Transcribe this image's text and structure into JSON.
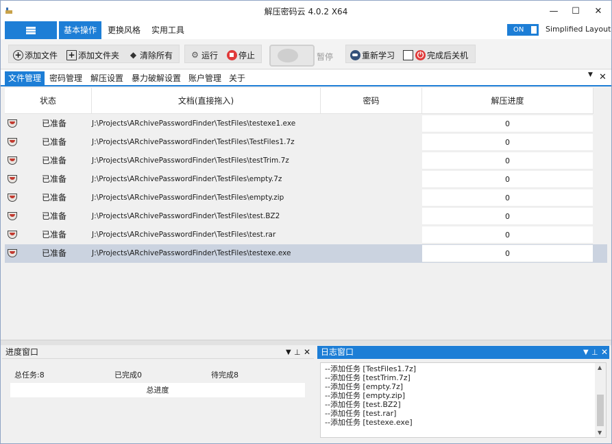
{
  "window": {
    "title": "解压密码云 4.0.2    X64",
    "minimize_glyph": "—",
    "maximize_glyph": "☐",
    "close_glyph": "✕"
  },
  "ribbon": {
    "tabs": [
      {
        "label": "基本操作",
        "active": true
      },
      {
        "label": "更换风格",
        "active": false
      },
      {
        "label": "实用工具",
        "active": false
      }
    ],
    "toggle_label": "ON",
    "layout_label": "Simplified Layout"
  },
  "toolbar": {
    "add_file": "添加文件",
    "add_folder": "添加文件夹",
    "clear_all": "清除所有",
    "run": "运行",
    "stop": "停止",
    "pause": "暂停",
    "relearn": "重新学习",
    "shutdown_after": "完成后关机"
  },
  "doc_tabs": [
    {
      "label": "文件管理",
      "active": true
    },
    {
      "label": "密码管理",
      "active": false
    },
    {
      "label": "解压设置",
      "active": false
    },
    {
      "label": "暴力破解设置",
      "active": false
    },
    {
      "label": "账户管理",
      "active": false
    },
    {
      "label": "关于",
      "active": false
    }
  ],
  "grid": {
    "columns": [
      "状态",
      "文档(直接拖入)",
      "密码",
      "解压进度"
    ],
    "rows": [
      {
        "status": "已准备",
        "path": "J:\\Projects\\ARchivePasswordFinder\\TestFiles\\testexe1.exe",
        "password": "",
        "progress": "0"
      },
      {
        "status": "已准备",
        "path": "J:\\Projects\\ARchivePasswordFinder\\TestFiles\\TestFiles1.7z",
        "password": "",
        "progress": "0"
      },
      {
        "status": "已准备",
        "path": "J:\\Projects\\ARchivePasswordFinder\\TestFiles\\testTrim.7z",
        "password": "",
        "progress": "0"
      },
      {
        "status": "已准备",
        "path": "J:\\Projects\\ARchivePasswordFinder\\TestFiles\\empty.7z",
        "password": "",
        "progress": "0"
      },
      {
        "status": "已准备",
        "path": "J:\\Projects\\ARchivePasswordFinder\\TestFiles\\empty.zip",
        "password": "",
        "progress": "0"
      },
      {
        "status": "已准备",
        "path": "J:\\Projects\\ARchivePasswordFinder\\TestFiles\\test.BZ2",
        "password": "",
        "progress": "0"
      },
      {
        "status": "已准备",
        "path": "J:\\Projects\\ARchivePasswordFinder\\TestFiles\\test.rar",
        "password": "",
        "progress": "0"
      },
      {
        "status": "已准备",
        "path": "J:\\Projects\\ARchivePasswordFinder\\TestFiles\\testexe.exe",
        "password": "",
        "progress": "0",
        "selected": true
      }
    ]
  },
  "progress_panel": {
    "title": "进度窗口",
    "total_tasks": "总任务:8",
    "completed": "已完成0",
    "pending": "待完成8",
    "total_progress": "总进度"
  },
  "log_panel": {
    "title": "日志窗口",
    "lines": [
      "--添加任务 [TestFiles1.7z]",
      "--添加任务 [testTrim.7z]",
      "--添加任务 [empty.7z]",
      "--添加任务 [empty.zip]",
      "--添加任务 [test.BZ2]",
      "--添加任务 [test.rar]",
      "--添加任务 [testexe.exe]"
    ]
  },
  "panel_controls": {
    "dropdown": "▼",
    "pin": "📌",
    "close": "✕"
  },
  "colors": {
    "accent": "#1d7ed6",
    "selected_row": "#cbd3e0"
  }
}
